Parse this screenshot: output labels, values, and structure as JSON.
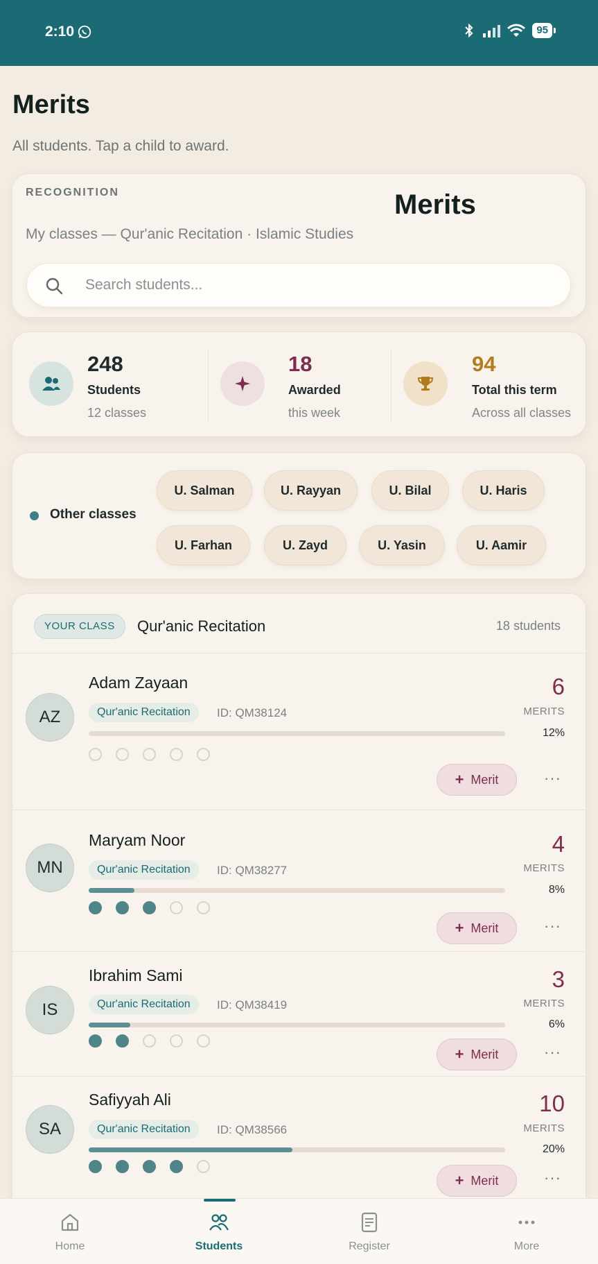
{
  "status_bar": {
    "time": "2:10",
    "battery": "95"
  },
  "page": {
    "title": "Merits",
    "subtitle": "All students. Tap a child to award."
  },
  "recognition": {
    "eyebrow": "RECOGNITION",
    "title": "Merits",
    "subtitle": "My classes — Qur'anic Recitation · Islamic Studies",
    "search_placeholder": "Search students..."
  },
  "stats": [
    {
      "number": "248",
      "label": "Students",
      "sub": "12 classes",
      "icon": "people-icon",
      "color": "#1f2a2c"
    },
    {
      "number": "18",
      "label": "Awarded",
      "sub": "this week",
      "icon": "sparkle-icon",
      "color": "#7d2d4e"
    },
    {
      "number": "94",
      "label": "Total this term",
      "sub": "Across all classes",
      "icon": "trophy-icon",
      "color": "#b07c1e"
    }
  ],
  "other_classes": {
    "label": "Other classes",
    "chips": [
      "U. Salman",
      "U. Rayyan",
      "U. Bilal",
      "U. Haris",
      "U. Farhan",
      "U. Zayd",
      "U. Yasin",
      "U. Aamir"
    ]
  },
  "your_class": {
    "badge": "YOUR CLASS",
    "name": "Qur'anic Recitation",
    "count": "18 students",
    "merit_button": "Merit",
    "merits_label": "MERITS",
    "more": "···",
    "students": [
      {
        "initials": "AZ",
        "name": "Adam Zayaan",
        "tag": "Qur'anic Recitation",
        "id": "ID: QM38124",
        "merits": "6",
        "percent": "12%",
        "progress": 0,
        "dots": [
          0,
          0,
          0,
          0,
          0
        ]
      },
      {
        "initials": "MN",
        "name": "Maryam Noor",
        "tag": "Qur'anic Recitation",
        "id": "ID: QM38277",
        "merits": "4",
        "percent": "8%",
        "progress": 0.11,
        "dots": [
          1,
          1,
          1,
          0,
          0
        ]
      },
      {
        "initials": "IS",
        "name": "Ibrahim Sami",
        "tag": "Qur'anic Recitation",
        "id": "ID: QM38419",
        "merits": "3",
        "percent": "6%",
        "progress": 0.1,
        "dots": [
          1,
          1,
          0,
          0,
          0
        ]
      },
      {
        "initials": "SA",
        "name": "Safiyyah Ali",
        "tag": "Qur'anic Recitation",
        "id": "ID: QM38566",
        "merits": "10",
        "percent": "20%",
        "progress": 0.49,
        "dots": [
          1,
          1,
          1,
          1,
          0
        ]
      }
    ]
  },
  "nav": [
    {
      "label": "Home",
      "icon": "home-icon"
    },
    {
      "label": "Students",
      "icon": "students-icon",
      "active": true
    },
    {
      "label": "Register",
      "icon": "register-icon"
    },
    {
      "label": "More",
      "icon": "more-icon"
    }
  ]
}
